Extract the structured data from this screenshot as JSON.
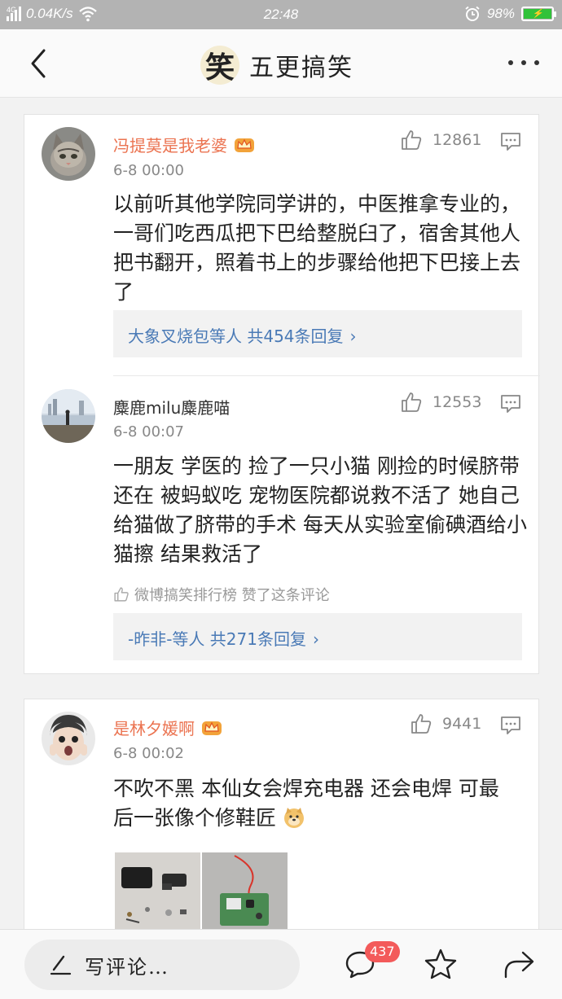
{
  "status_bar": {
    "network": "4G",
    "speed": "0.04K/s",
    "time": "22:48",
    "battery": "98%"
  },
  "header": {
    "logo_char": "笑",
    "title": "五更搞笑"
  },
  "comments": [
    {
      "username": "冯提莫是我老婆",
      "time": "6-8 00:00",
      "likes": "12861",
      "text": "以前听其他学院同学讲的，中医推拿专业的，一哥们吃西瓜把下巴给整脱臼了，宿舍其他人把书翻开，照着书上的步骤给他把下巴接上去了",
      "replies": "大象叉烧包等人  共454条回复"
    },
    {
      "username": "麋鹿milu麋鹿喵",
      "time": "6-8 00:07",
      "likes": "12553",
      "text": "一朋友 学医的 捡了一只小猫 刚捡的时候脐带还在 被蚂蚁吃 宠物医院都说救不活了 她自己给猫做了脐带的手术 每天从实验室偷碘酒给小猫擦 结果救活了",
      "liked_by": "微博搞笑排行榜 赞了这条评论",
      "replies": "-昨非-等人  共271条回复"
    },
    {
      "username": "是林夕媛啊",
      "time": "6-8 00:02",
      "likes": "9441",
      "text": "不吹不黑  本仙女会焊充电器  还会电焊  可最后一张像个修鞋匠"
    }
  ],
  "bottom_bar": {
    "write_label": "写评论…",
    "comment_count": "437"
  },
  "colors": {
    "vip_name": "#eb7350",
    "link": "#4a7ab6",
    "badge": "#f35a5a"
  }
}
